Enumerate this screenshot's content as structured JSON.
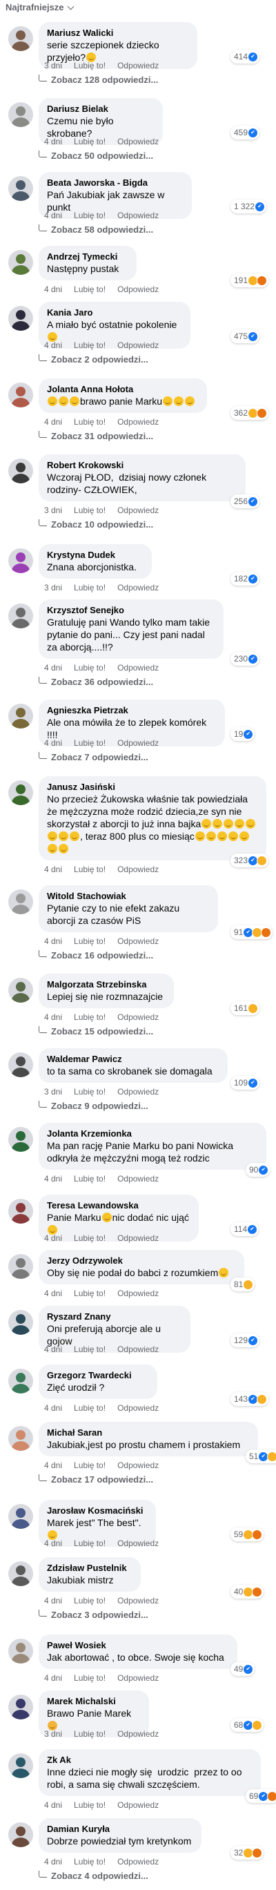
{
  "sort": {
    "label": "Najtrafniejsze"
  },
  "actions": {
    "age": "4 dni",
    "like": "Lubię to!",
    "reply": "Odpowiedz"
  },
  "comments": [
    {
      "author": "Mariusz Walicki",
      "text": "serie szczepionek dziecko przyjeło?",
      "emoji": [
        "haha"
      ],
      "age": "3 dni",
      "reactions": "414",
      "reaction_icons": [
        "like"
      ],
      "replies": "Zobacz 128 odpowiedzi...",
      "avatar": "#7a5c4a"
    },
    {
      "author": "Dariusz Bielak",
      "text": "Czemu nie było skrobane?",
      "emoji": [],
      "age": "4 dni",
      "reactions": "459",
      "reaction_icons": [
        "like"
      ],
      "replies": "Zobacz 50 odpowiedzi...",
      "avatar": "#8a8a86"
    },
    {
      "author": "Beata Jaworska - Bigda",
      "text": "Pań Jakubiak jak zawsze w punkt",
      "emoji": [],
      "age": "4 dni",
      "reactions": "1 322",
      "reaction_icons": [
        "like"
      ],
      "replies": "Zobacz 58 odpowiedzi...",
      "avatar": "#4a5a6a"
    },
    {
      "author": "Andrzej Tymecki",
      "text": "Następny pustak",
      "emoji": [],
      "age": "4 dni",
      "reactions": "191",
      "reaction_icons": [
        "haha",
        "angry"
      ],
      "replies": "",
      "avatar": "#5a7a3a"
    },
    {
      "author": "Kania Jaro",
      "text": "A miało być ostatnie pokolenie",
      "emoji": [
        "sad"
      ],
      "age": "4 dni",
      "reactions": "475",
      "reaction_icons": [
        "like"
      ],
      "replies": "Zobacz 2 odpowiedzi...",
      "avatar": "#2a2a3a"
    },
    {
      "author": "Jolanta Anna Hołota",
      "text": "brawo panie Marku",
      "emoji_before": [
        "haha",
        "haha",
        "haha"
      ],
      "emoji": [
        "haha",
        "haha",
        "haha"
      ],
      "age": "4 dni",
      "reactions": "362",
      "reaction_icons": [
        "haha",
        "angry"
      ],
      "replies": "Zobacz 31 odpowiedzi...",
      "avatar": "#b05a4a"
    },
    {
      "author": "Robert Krokowski",
      "text": "Wczoraj PŁOD,  dzisiaj nowy członek rodziny- CZŁOWIEK,",
      "emoji": [],
      "age": "3 dni",
      "reactions": "256",
      "reaction_icons": [
        "like"
      ],
      "replies": "Zobacz 10 odpowiedzi...",
      "avatar": "#3a3a3a"
    },
    {
      "author": "Krystyna Dudek",
      "text": "Znana aborcjonistka.",
      "emoji": [],
      "age": "3 dni",
      "reactions": "182",
      "reaction_icons": [
        "like"
      ],
      "replies": "",
      "avatar": "#9b3fb5"
    },
    {
      "author": "Krzysztof Senejko",
      "text": "Gratuluję pani Wando tylko mam takie pytanie do pani... Czy jest pani nadal za aborcją....!!?",
      "emoji": [],
      "age": "4 dni",
      "reactions": "230",
      "reaction_icons": [
        "like"
      ],
      "replies": "Zobacz 36 odpowiedzi...",
      "avatar": "#6a6a6a"
    },
    {
      "author": "Agnieszka Pietrzak",
      "text": "Ale ona mówiła że to zlepek komórek !!!!",
      "emoji": [],
      "age": "4 dni",
      "reactions": "19",
      "reaction_icons": [
        "like"
      ],
      "replies": "Zobacz 7 odpowiedzi...",
      "avatar": "#7a6a3a"
    },
    {
      "author": "Janusz Jasiński",
      "text": "No przecież Żukowska właśnie tak powiedziała że mężczyzna może rodzić dziecia,ze syn nie skorzystał z aborcji to już inna bajka",
      "emoji": [
        "haha",
        "haha",
        "haha",
        "haha",
        "haha",
        "haha",
        "haha",
        "haha"
      ],
      "text2": ", teraz 800 plus co miesiąc",
      "emoji2": [
        "haha",
        "haha",
        "haha",
        "haha",
        "haha",
        "haha",
        "haha"
      ],
      "age": "4 dni",
      "reactions": "323",
      "reaction_icons": [
        "like",
        "haha"
      ],
      "replies": "",
      "avatar": "#3a6a2a"
    },
    {
      "author": "Witold Stachowiak",
      "text": "Pytanie czy to nie efekt zakazu aborcji za czasów PiS",
      "emoji": [],
      "age": "4 dni",
      "reactions": "91",
      "reaction_icons": [
        "like",
        "haha",
        "angry"
      ],
      "replies": "Zobacz 16 odpowiedzi...",
      "avatar": "#9a9a9a"
    },
    {
      "author": "Malgorzata Strzebinska",
      "text": "Lepiej się nie rozmnazajcie",
      "emoji": [],
      "age": "4 dni",
      "reactions": "161",
      "reaction_icons": [
        "haha"
      ],
      "replies": "Zobacz 15 odpowiedzi...",
      "avatar": "#5a6a4a"
    },
    {
      "author": "Waldemar Pawicz",
      "text": "to ta sama co skrobanek sie domagala",
      "emoji": [],
      "age": "3 dni",
      "reactions": "109",
      "reaction_icons": [
        "like"
      ],
      "replies": "Zobacz 9 odpowiedzi...",
      "avatar": "#4a4a4a"
    },
    {
      "author": "Jolanta Krzemionka",
      "text": "Ma pan rację Panie Marku bo pani Nowicka odkryła że mężczyźni mogą też rodzic",
      "emoji": [],
      "age": "4 dni",
      "reactions": "90",
      "reaction_icons": [
        "like"
      ],
      "replies": "",
      "avatar": "#2a6a3a"
    },
    {
      "author": "Teresa Lewandowska",
      "text": "Panie Marku",
      "emoji": [
        "like"
      ],
      "text2": "nic dodać nic ująć",
      "emoji2": [
        "like"
      ],
      "age": "4 dni",
      "reactions": "114",
      "reaction_icons": [
        "like"
      ],
      "replies": "",
      "avatar": "#8a3a3a"
    },
    {
      "author": "Jerzy Odrzywolek",
      "text": "Oby się nie podał do babci z rozumkiem",
      "emoji": [
        "haha"
      ],
      "age": "4 dni",
      "reactions": "81",
      "reaction_icons": [
        "haha"
      ],
      "replies": "",
      "avatar": "#7a7a7a"
    },
    {
      "author": "Ryszard Znany",
      "text": "Oni preferują aborcje ale u gojow",
      "emoji": [],
      "age": "4 dni",
      "reactions": "129",
      "reaction_icons": [
        "like"
      ],
      "replies": "",
      "avatar": "#2a4a5a"
    },
    {
      "author": "Grzegorz Twardecki",
      "text": "Zięć urodził ?",
      "emoji": [],
      "age": "4 dni",
      "reactions": "143",
      "reaction_icons": [
        "like",
        "haha"
      ],
      "replies": "",
      "avatar": "#3a7a5a"
    },
    {
      "author": "Michał Saran",
      "text": "Jakubiak,jest po prostu chamem i prostakiem",
      "emoji": [],
      "age": "4 dni",
      "reactions": "51",
      "reaction_icons": [
        "like",
        "haha",
        "angry"
      ],
      "replies": "Zobacz 17 odpowiedzi...",
      "avatar": "#d08a6a"
    },
    {
      "author": "Jarosław Kosmaciński",
      "text": "Marek jest\" The best\".",
      "emoji": [
        "like"
      ],
      "age": "4 dni",
      "reactions": "59",
      "reaction_icons": [
        "haha",
        "angry"
      ],
      "replies": "",
      "avatar": "#4a5a8a"
    },
    {
      "author": "Zdzisław Pustelnik",
      "text": "Jakubiak mistrz",
      "emoji": [],
      "age": "4 dni",
      "reactions": "40",
      "reaction_icons": [
        "haha",
        "angry"
      ],
      "replies": "Zobacz 3 odpowiedzi...",
      "avatar": "#5a5a5a"
    },
    {
      "author": "Paweł Wosiek",
      "text": "Jak abortować , to obce. Swoje się kocha",
      "emoji": [],
      "age": "4 dni",
      "reactions": "49",
      "reaction_icons": [
        "like"
      ],
      "replies": "",
      "avatar": "#9a8a7a"
    },
    {
      "author": "Marek Michalski",
      "text": "Brawo Panie Marek",
      "emoji": [
        "clap"
      ],
      "age": "3 dni",
      "reactions": "68",
      "reaction_icons": [
        "like",
        "haha"
      ],
      "replies": "",
      "avatar": "#3a3a6a"
    },
    {
      "author": "Zk Ak",
      "text": "Inne dzieci nie mogły się  urodzic  przez to oo robi, a sama się chwali szczęściem.",
      "emoji": [],
      "age": "4 dni",
      "reactions": "69",
      "reaction_icons": [
        "like",
        "angry"
      ],
      "replies": "",
      "avatar": "#2a5a6a"
    },
    {
      "author": "Damian Kuryła",
      "text": "Dobrze powiedział tym kretynkom",
      "emoji": [],
      "age": "4 dni",
      "reactions": "32",
      "reaction_icons": [
        "haha",
        "angry"
      ],
      "replies": "Zobacz 4 odpowiedzi...",
      "avatar": "#6a4a3a"
    }
  ]
}
